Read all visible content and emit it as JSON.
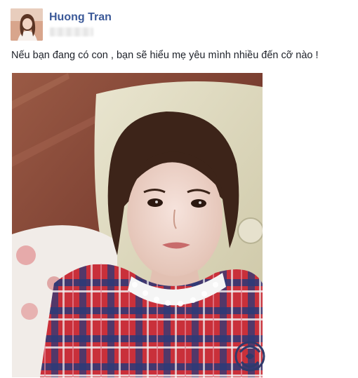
{
  "post": {
    "author_name": "Huong Tran",
    "caption": "Nếu bạn đang có con , bạn sẽ hiểu mẹ yêu mình nhiều đến cỡ nào !"
  },
  "icons": {
    "avatar": "profile-photo",
    "watermark": "logo-watermark"
  }
}
